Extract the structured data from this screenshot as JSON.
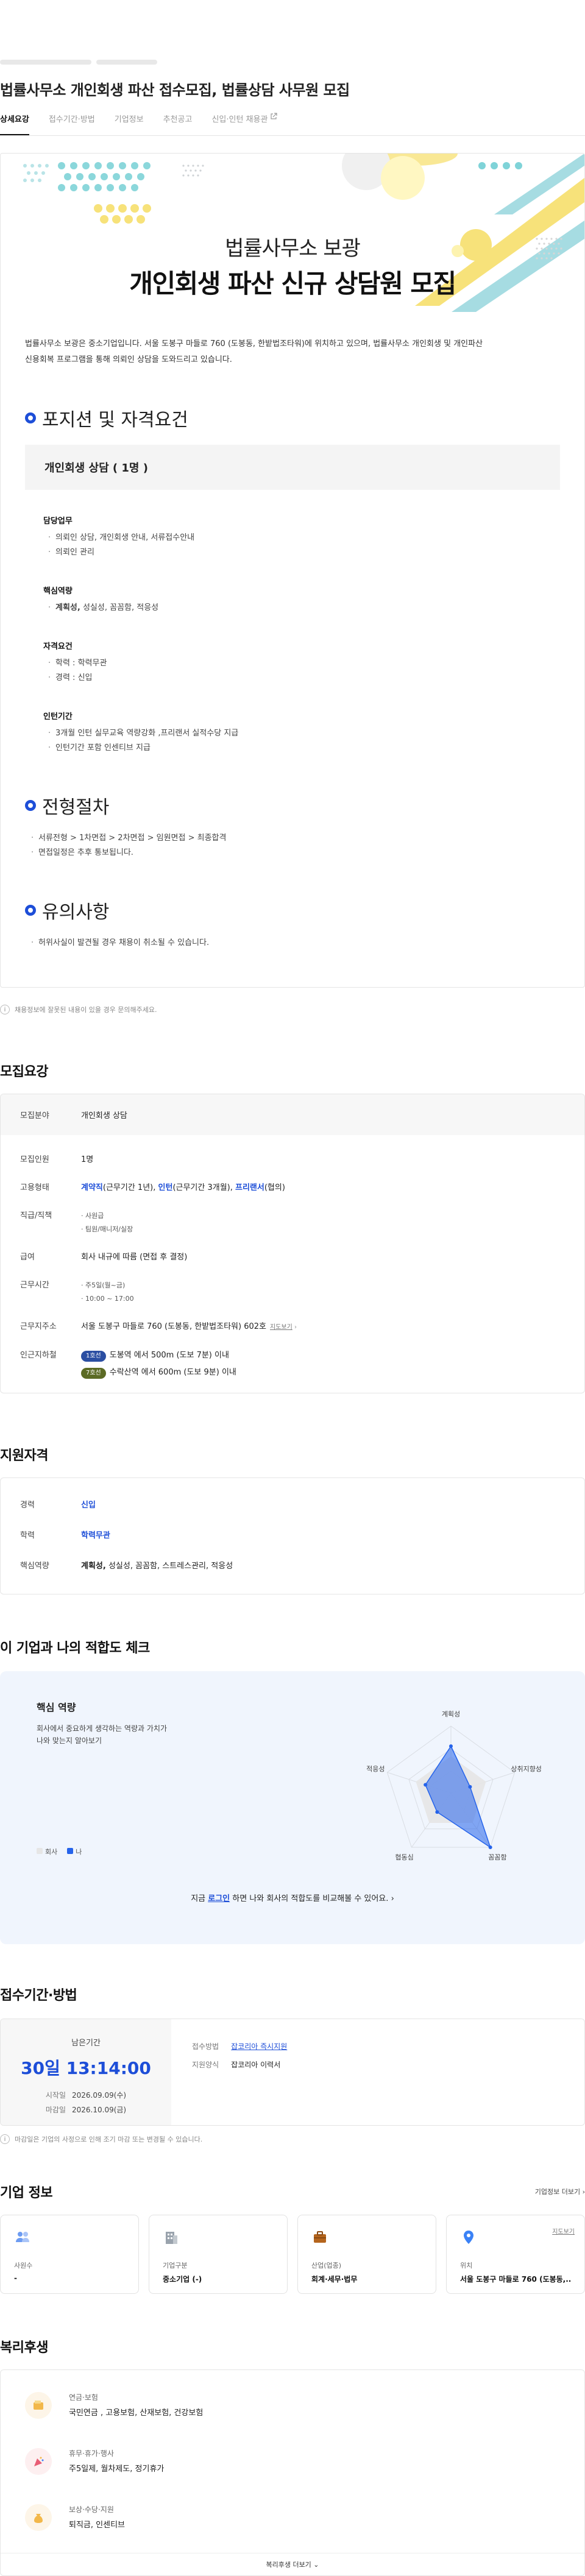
{
  "header": {
    "title": "법률사무소 개인회생 파산 접수모집, 법률상담 사무원 모집",
    "tabs": [
      "상세요강",
      "접수기간·방법",
      "기업정보",
      "추천공고",
      "신입·인턴 채용관"
    ]
  },
  "poster": {
    "hero_sub": "법률사무소 보광",
    "hero_main": "개인회생 파산 신규 상담원 모집",
    "intro_line1": "법률사무소 보광은 중소기업입니다. 서울 도봉구 마들로 760 (도봉동, 한밭법조타워)에 위치하고 있으며, 법률사무소 개인회생 및 개인파산",
    "intro_line2": "신용회복 프로그램을 통해 의뢰인 상담을 도와드리고 있습니다.",
    "section1": "포지션 및 자격요건",
    "position": "개인회생 상담 ( 1명 )",
    "groups": [
      {
        "title": "담당업무",
        "items": [
          "의뢰인 상담, 개인회생 안내, 서류접수안내",
          "의뢰인 관리"
        ]
      },
      {
        "title": "핵심역량",
        "bold": "계획성,",
        "rest": " 성실성, 꼼꼼함, 적응성"
      },
      {
        "title": "자격요건",
        "items": [
          "학력 : 학력무관",
          "경력 : 신입"
        ]
      },
      {
        "title": "인턴기간",
        "items": [
          "3개월 인턴 실무교육 역량강화 ,프리랜서 실적수당 지급",
          "인턴기간 포함 인센티브 지급"
        ]
      }
    ],
    "section2": "전형절차",
    "process": [
      "서류전형 > 1차면접 > 2차면접 > 임원면접 > 최종합격",
      "면접일정은 추후 통보됩니다."
    ],
    "section3": "유의사항",
    "caution": [
      "허위사실이 발견될 경우 채용이 취소될 수 있습니다."
    ]
  },
  "notice1": "채용정보에 잘못된 내용이 있을 경우 문의해주세요.",
  "summary": {
    "title": "모집요강",
    "rows": {
      "field_k": "모집분야",
      "field_v": "개인회생 상담",
      "count_k": "모집인원",
      "count_v": "1명",
      "type_k": "고용형태",
      "type_a": "계약직",
      "type_a2": "(근무기간 1년), ",
      "type_b": "인턴",
      "type_b2": "(근무기간 3개월), ",
      "type_c": "프리랜서",
      "type_c2": "(협의)",
      "rank_k": "직급/직책",
      "rank_v1": "사원급",
      "rank_v2": "팀원/매니저/실장",
      "pay_k": "급여",
      "pay_v": "회사 내규에 따름 (면접 후 결정)",
      "time_k": "근무시간",
      "time_v1": "주5일(월~금)",
      "time_v2": "10:00 ~ 17:00",
      "addr_k": "근무지주소",
      "addr_v": "서울 도봉구 마들로 760 (도봉동, 한밭법조타워) 602호",
      "addr_link": "지도보기",
      "subway_k": "인근지하철",
      "line1": "1호선",
      "line1_v": "도봉역 에서 500m (도보 7분) 이내",
      "line7": "7호선",
      "line7_v": "수락산역 에서 600m (도보 9분) 이내"
    }
  },
  "qualification": {
    "title": "지원자격",
    "career_k": "경력",
    "career_v": "신입",
    "edu_k": "학력",
    "edu_v": "학력무관",
    "core_k": "핵심역량",
    "core_bold": "계획성,",
    "core_rest": " 성실성, 꼼꼼함, 스트레스관리, 적응성"
  },
  "fit": {
    "title": "이 기업과 나의 적합도 체크",
    "sub": "핵심 역량",
    "desc1": "회사에서 중요하게 생각하는 역량과 가치가",
    "desc2": "나와 맞는지 알아보기",
    "legend_company": "회사",
    "legend_me": "나",
    "axes": [
      "계획성",
      "상취지향성",
      "꼼꼼함",
      "협동심",
      "적응성"
    ],
    "cta_pre": "지금 ",
    "cta_link": "로그인",
    "cta_post": " 하면 나와 회사의 적합도를 비교해볼 수 있어요.",
    "chart_data": {
      "type": "radar",
      "axes": [
        "계획성",
        "상취지향성",
        "꼼꼼함",
        "협동심",
        "적응성"
      ],
      "series": [
        {
          "name": "회사",
          "values": [
            0.55,
            0.55,
            0.55,
            0.55,
            0.55
          ],
          "color": "#e6e6e6"
        },
        {
          "name": "나",
          "values": [
            0.7,
            0.3,
            1.0,
            0.35,
            0.4
          ],
          "color": "#2563eb"
        }
      ]
    }
  },
  "apply": {
    "title": "접수기간·방법",
    "remain_label": "남은기간",
    "remain": "30일 13:14:00",
    "start_k": "시작일",
    "start_v": "2026.09.09(수)",
    "end_k": "마감일",
    "end_v": "2026.10.09(금)",
    "method_k": "접수방법",
    "method_v": "잡코리아 즉시지원",
    "form_k": "지원양식",
    "form_v": "잡코리아 이력서",
    "notice": "마감일은 기업의 사정으로 인해 조기 마감 또는 변경될 수 있습니다."
  },
  "company": {
    "title": "기업 정보",
    "more": "기업정보 더보기",
    "cards": [
      {
        "label": "사원수",
        "value": "-",
        "icon": "people-icon"
      },
      {
        "label": "기업구분",
        "value": "중소기업 (-)",
        "icon": "building-icon"
      },
      {
        "label": "산업(업종)",
        "value": "회계·세무·법무",
        "icon": "briefcase-icon"
      },
      {
        "label": "위치",
        "value": "서울 도봉구 마들로 760 (도봉동,...",
        "icon": "pin-icon",
        "link": "지도보기"
      }
    ]
  },
  "welfare": {
    "title": "복리후생",
    "items": [
      {
        "title": "연금·보험",
        "desc": "국민연금 , 고용보험, 산재보험, 건강보험",
        "icon": "wallet-icon"
      },
      {
        "title": "휴무·휴가·행사",
        "desc": "주5일제, 월차제도, 정기휴가",
        "icon": "party-icon"
      },
      {
        "title": "보상·수당·지원",
        "desc": "퇴직금, 인센티브",
        "icon": "money-bag-icon"
      }
    ],
    "more": "복리후생 더보기"
  }
}
